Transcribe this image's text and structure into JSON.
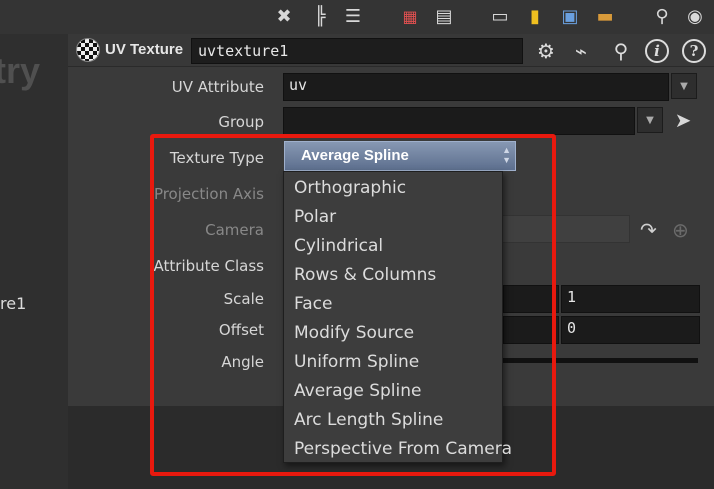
{
  "left_pane": {
    "partial_title": "try",
    "partial_node": "re1"
  },
  "header": {
    "node_type": "UV Texture",
    "node_name": "uvtexture1"
  },
  "params": {
    "uv_attribute": {
      "label": "UV Attribute",
      "value": "uv"
    },
    "group": {
      "label": "Group",
      "value": ""
    },
    "texture_type": {
      "label": "Texture Type",
      "selected": "Average Spline"
    },
    "projection_axis": {
      "label": "Projection Axis"
    },
    "camera": {
      "label": "Camera"
    },
    "attribute_class": {
      "label": "Attribute Class"
    },
    "scale": {
      "label": "Scale",
      "value_y": "1"
    },
    "offset": {
      "label": "Offset",
      "value_y": "0"
    },
    "angle": {
      "label": "Angle"
    }
  },
  "menu": {
    "options": [
      "Orthographic",
      "Polar",
      "Cylindrical",
      "Rows & Columns",
      "Face",
      "Modify Source",
      "Uniform Spline",
      "Average Spline",
      "Arc Length Spline",
      "Perspective From Camera"
    ]
  },
  "colors": {
    "highlight": "#e8190e",
    "selected_bg": "#6f80a0"
  },
  "icons": {
    "toolbar": [
      "tools-icon",
      "tree-icon",
      "list-icon",
      "palette-icon",
      "grid-icon",
      "layout-icon",
      "sticky-note-icon",
      "image-add-icon",
      "box-icon",
      "search-icon",
      "eye-icon"
    ],
    "header": [
      "gear-icon",
      "broom-icon",
      "search-icon",
      "info-icon",
      "help-icon"
    ]
  }
}
